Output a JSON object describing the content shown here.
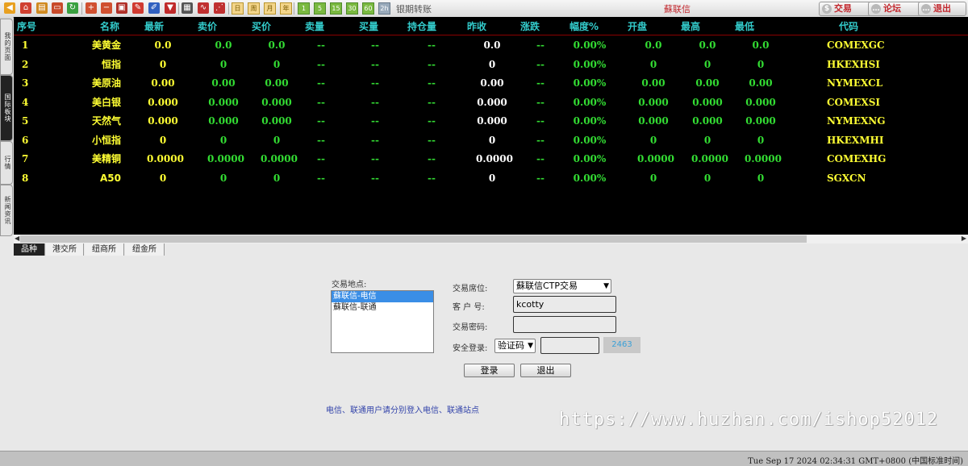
{
  "toolbar": {
    "transfer_label": "银期转账",
    "window_title": "蘇联信",
    "period_buttons": [
      "日",
      "周",
      "月",
      "年"
    ],
    "minute_buttons": [
      "1",
      "5",
      "15",
      "30",
      "60",
      "2h"
    ],
    "trade_label": "交易",
    "forum_label": "论坛",
    "exit_label": "退出"
  },
  "sidetabs": [
    "我的页面",
    "国际板块",
    "行情",
    "新闻资讯"
  ],
  "grid": {
    "headers": [
      "序号",
      "名称",
      "最新",
      "卖价",
      "买价",
      "卖量",
      "买量",
      "持仓量",
      "昨收",
      "涨跌",
      "幅度%",
      "开盘",
      "最高",
      "最低",
      "代码"
    ],
    "rows": [
      [
        "1",
        "美黄金",
        "0.0",
        "0.0",
        "0.0",
        "--",
        "--",
        "--",
        "0.0",
        "--",
        "0.00%",
        "0.0",
        "0.0",
        "0.0",
        "COMEXGC"
      ],
      [
        "2",
        "恒指",
        "0",
        "0",
        "0",
        "--",
        "--",
        "--",
        "0",
        "--",
        "0.00%",
        "0",
        "0",
        "0",
        "HKEXHSI"
      ],
      [
        "3",
        "美原油",
        "0.00",
        "0.00",
        "0.00",
        "--",
        "--",
        "--",
        "0.00",
        "--",
        "0.00%",
        "0.00",
        "0.00",
        "0.00",
        "NYMEXCL"
      ],
      [
        "4",
        "美白银",
        "0.000",
        "0.000",
        "0.000",
        "--",
        "--",
        "--",
        "0.000",
        "--",
        "0.00%",
        "0.000",
        "0.000",
        "0.000",
        "COMEXSI"
      ],
      [
        "5",
        "天然气",
        "0.000",
        "0.000",
        "0.000",
        "--",
        "--",
        "--",
        "0.000",
        "--",
        "0.00%",
        "0.000",
        "0.000",
        "0.000",
        "NYMEXNG"
      ],
      [
        "6",
        "小恒指",
        "0",
        "0",
        "0",
        "--",
        "--",
        "--",
        "0",
        "--",
        "0.00%",
        "0",
        "0",
        "0",
        "HKEXMHI"
      ],
      [
        "7",
        "美精铜",
        "0.0000",
        "0.0000",
        "0.0000",
        "--",
        "--",
        "--",
        "0.0000",
        "--",
        "0.00%",
        "0.0000",
        "0.0000",
        "0.0000",
        "COMEXHG"
      ],
      [
        "8",
        "A50",
        "0",
        "0",
        "0",
        "--",
        "--",
        "--",
        "0",
        "--",
        "0.00%",
        "0",
        "0",
        "0",
        "SGXCN"
      ]
    ]
  },
  "bottom_tabs": [
    "品种",
    "港交所",
    "纽商所",
    "纽金所"
  ],
  "login": {
    "location_label": "交易地点:",
    "locations": [
      "蘇联信-电信",
      "蘇联信-联通"
    ],
    "seat_label": "交易席位:",
    "seat_value": "蘇联信CTP交易",
    "account_label": "客 户 号:",
    "account_value": "kcotty",
    "password_label": "交易密码:",
    "password_value": "",
    "security_label": "安全登录:",
    "security_value": "验证码",
    "captcha_input": "",
    "captcha_code": "2463",
    "login_button": "登录",
    "exit_button": "退出",
    "note": "电信、联通用户请分别登入电信、联通站点"
  },
  "watermark": "https://www.huzhan.com/ishop52012",
  "status": {
    "time": "Tue Sep 17 2024 02:34:31 GMT+0800 (中国标准时间)"
  }
}
